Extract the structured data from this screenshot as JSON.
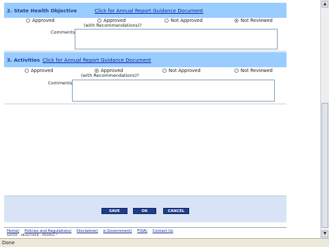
{
  "sections": [
    {
      "title": "2. State Health Objective",
      "link": "Click for Annual Report Guidance Document",
      "options": [
        "Approved",
        "Approved",
        "Not Approved",
        "Not Reviewed"
      ],
      "sub_label": "(with Recommendations)?",
      "selected_index": 3,
      "comments_label": "Comments:"
    },
    {
      "title": "3. Activities",
      "link": "Click for Annual Report Guidance Document",
      "options": [
        "Approved",
        "Approved",
        "Not Approved",
        "Not Reviewed"
      ],
      "sub_label": "(with Recommendations)?",
      "selected_index": 1,
      "comments_label": "Comments:"
    }
  ],
  "buttons": {
    "save": "SAVE",
    "ok": "OK",
    "cancel": "CANCEL"
  },
  "footer": {
    "links": [
      "Home|",
      "Policies and Regulations|",
      "Disclaimer|",
      "e-Government|",
      "FOIA|",
      "Contact Us"
    ],
    "tagline": "SAFER · HEALTHIER · PEOPLE™"
  },
  "status_bar": "Done",
  "colors": {
    "section_header": "#99ccff",
    "button": "#1f3d8a",
    "panel": "#d8e4f5"
  }
}
